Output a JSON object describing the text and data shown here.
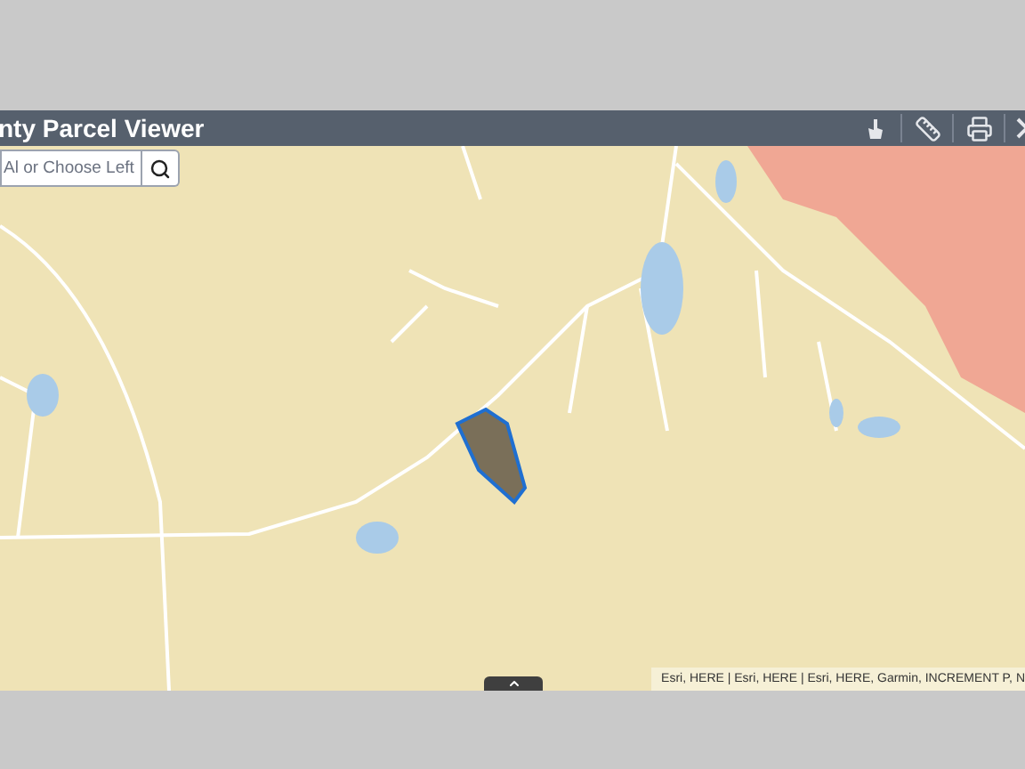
{
  "header": {
    "title": "nty Parcel Viewer"
  },
  "search": {
    "placeholder": "Al or Choose Left"
  },
  "map": {
    "attribution": "Esri, HERE | Esri, HERE | Esri, HERE, Garmin, INCREMENT P, N"
  }
}
